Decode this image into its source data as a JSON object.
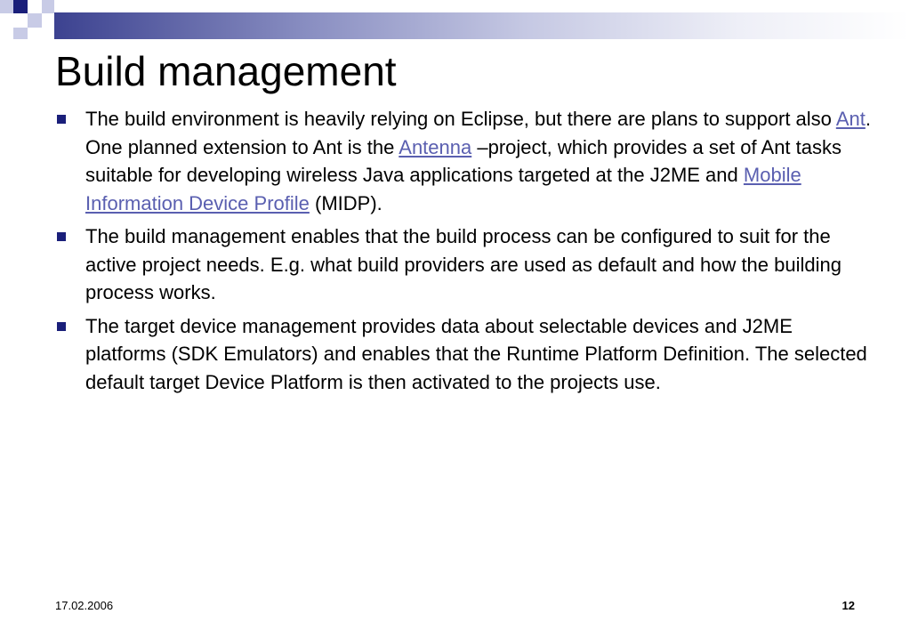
{
  "slide": {
    "title": "Build management",
    "bullets": [
      {
        "parts": [
          {
            "text": "The build environment is heavily relying on Eclipse, but there are plans to support also "
          },
          {
            "text": "Ant",
            "link": true
          },
          {
            "text": ". One planned extension to Ant is the "
          },
          {
            "text": "Antenna",
            "link": true
          },
          {
            "text": " –project, which provides a set of Ant tasks suitable for developing wireless Java applications targeted at the J2ME and "
          },
          {
            "text": "Mobile Information Device Profile",
            "link": true
          },
          {
            "text": " (MIDP)."
          }
        ]
      },
      {
        "parts": [
          {
            "text": "The build management enables that the build process can be configured to suit for the active project needs. E.g. what build providers are used as default and how the building process works."
          }
        ]
      },
      {
        "parts": [
          {
            "text": "The target device management provides data about selectable devices and J2ME platforms (SDK Emulators) and enables that the Runtime Platform Definition. The selected default target Device Platform is then activated to the projects use."
          }
        ]
      }
    ],
    "footer": {
      "date": "17.02.2006",
      "page_number": "12"
    },
    "colors": {
      "accent": "#1a1f7a",
      "link": "#5a5fb0",
      "deco_light": "#c8cbe6"
    }
  }
}
